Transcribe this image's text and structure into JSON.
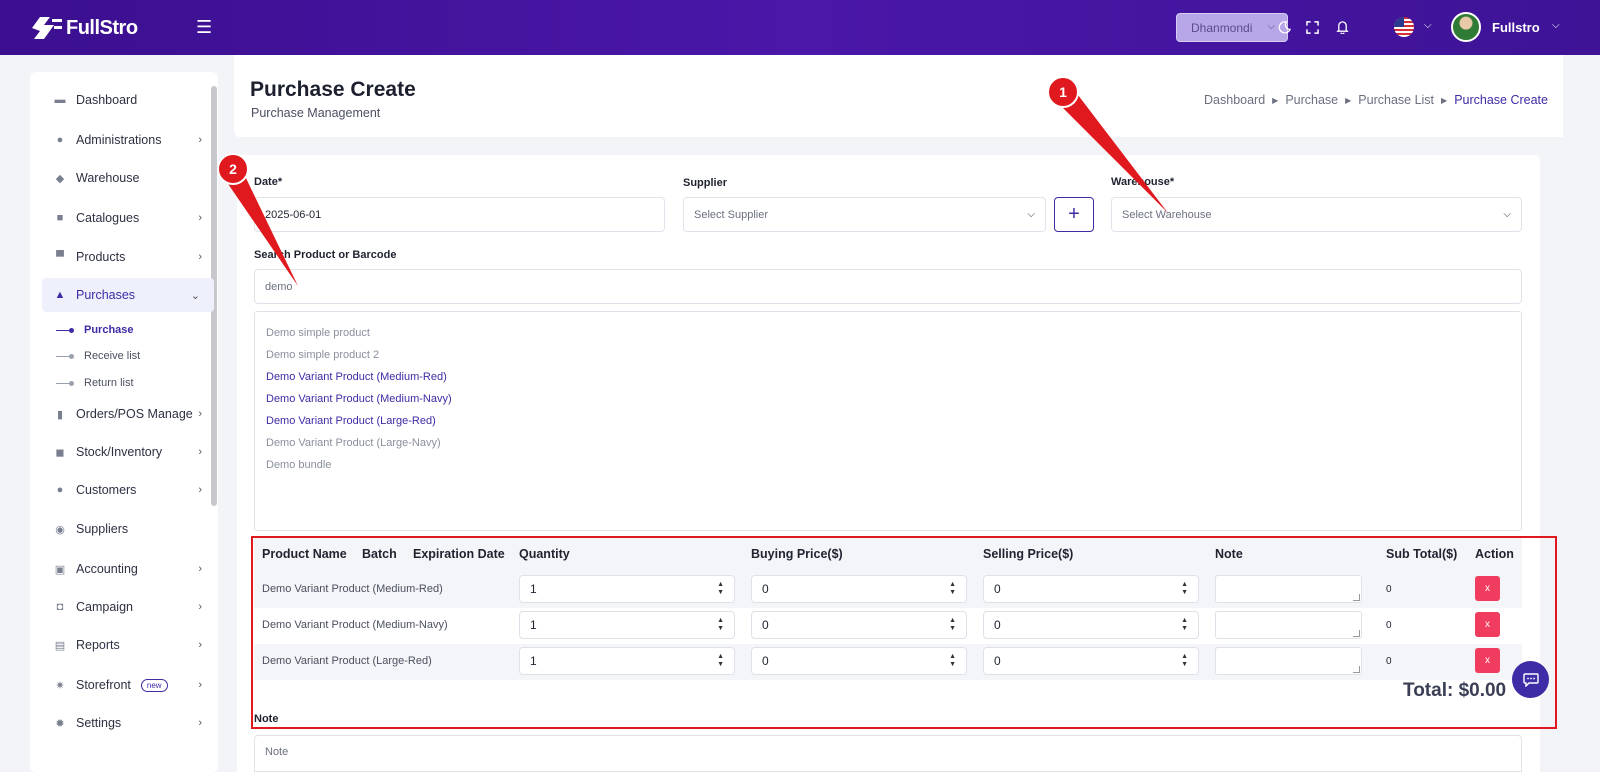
{
  "header": {
    "logo_text": "FullStro",
    "branch": "Dhanmondi",
    "user_name": "Fullstro",
    "icons": [
      "menu-icon",
      "moon-icon",
      "fullscreen-icon",
      "bell-icon",
      "flag-us-icon",
      "chevron-down-icon"
    ]
  },
  "sidebar": {
    "items": [
      {
        "label": "Dashboard",
        "icon": "monitor-icon"
      },
      {
        "label": "Administrations",
        "icon": "user-icon"
      },
      {
        "label": "Warehouse",
        "icon": "warehouse-icon"
      },
      {
        "label": "Catalogues",
        "icon": "catalogue-icon"
      },
      {
        "label": "Products",
        "icon": "products-icon"
      },
      {
        "label": "Purchases",
        "icon": "bag-icon"
      },
      {
        "label": "Orders/POS Manage",
        "icon": "orders-icon"
      },
      {
        "label": "Stock/Inventory",
        "icon": "stock-icon"
      },
      {
        "label": "Customers",
        "icon": "customers-icon"
      },
      {
        "label": "Suppliers",
        "icon": "suppliers-icon"
      },
      {
        "label": "Accounting",
        "icon": "accounting-icon"
      },
      {
        "label": "Campaign",
        "icon": "campaign-icon"
      },
      {
        "label": "Reports",
        "icon": "reports-icon"
      },
      {
        "label": "Storefront",
        "icon": "storefront-icon"
      },
      {
        "label": "Settings",
        "icon": "settings-icon"
      }
    ],
    "sub_items": [
      "Purchase",
      "Receive list",
      "Return list"
    ],
    "new_badge": "new"
  },
  "page": {
    "title": "Purchase Create",
    "subtitle": "Purchase Management",
    "breadcrumb": [
      "Dashboard",
      "Purchase",
      "Purchase List",
      "Purchase Create"
    ]
  },
  "form": {
    "date_label": "Date*",
    "date_value": "2025-06-01",
    "supplier_label": "Supplier",
    "supplier_placeholder": "Select Supplier",
    "add_label": "+",
    "warehouse_label": "Warehouse*",
    "warehouse_placeholder": "Select Warehouse",
    "search_label": "Search Product or Barcode",
    "search_value": "demo",
    "results": [
      "Demo simple product",
      "Demo simple product 2",
      "Demo Variant Product (Medium-Red)",
      "Demo Variant Product (Medium-Navy)",
      "Demo Variant Product (Large-Red)",
      "Demo Variant Product (Large-Navy)",
      "Demo bundle"
    ]
  },
  "table": {
    "headers": [
      "Product Name",
      "Batch",
      "Expiration Date",
      "Quantity",
      "Buying Price($)",
      "Selling Price($)",
      "Note",
      "Sub Total($)",
      "Action"
    ],
    "rows": [
      {
        "name": "Demo Variant Product (Medium-Red)",
        "qty": "1",
        "buy": "0",
        "sell": "0",
        "sub": "0",
        "action": "x"
      },
      {
        "name": "Demo Variant Product (Medium-Navy)",
        "qty": "1",
        "buy": "0",
        "sell": "0",
        "sub": "0",
        "action": "x"
      },
      {
        "name": "Demo Variant Product (Large-Red)",
        "qty": "1",
        "buy": "0",
        "sell": "0",
        "sub": "0",
        "action": "x"
      }
    ],
    "total": "Total: $0.00"
  },
  "note": {
    "label": "Note",
    "placeholder": "Note"
  },
  "annotations": [
    "1",
    "2"
  ],
  "colors": {
    "header": "#4a17a8",
    "accent": "#3d2ca6",
    "danger": "#f03c5f",
    "annotation": "#e0191f"
  }
}
